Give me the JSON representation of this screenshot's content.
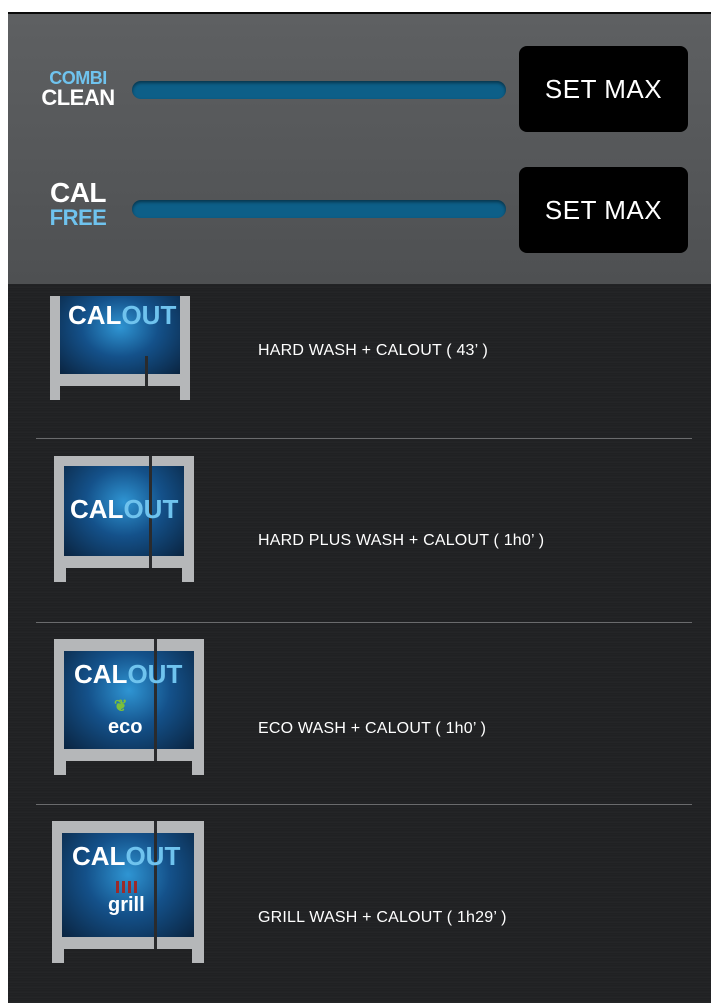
{
  "top_panel": {
    "combi_clean": {
      "line1": "COMBI",
      "line2": "CLEAN",
      "set_label": "SET MAX"
    },
    "cal_free": {
      "line1": "CAL",
      "line2": "FREE",
      "set_label": "SET MAX"
    }
  },
  "programs": [
    {
      "label": "HARD WASH + CALOUT ( 43’ )",
      "icon": {
        "a": "CAL",
        "b": "OUT"
      }
    },
    {
      "label": "HARD PLUS WASH + CALOUT ( 1h0’ )",
      "icon": {
        "a": "CAL",
        "b": "OUT"
      }
    },
    {
      "label": "ECO WASH + CALOUT ( 1h0’ )",
      "icon": {
        "a": "CAL",
        "b": "OUT",
        "sub": "eco"
      }
    },
    {
      "label": "GRILL WASH + CALOUT ( 1h29’ )",
      "icon": {
        "a": "CAL",
        "b": "OUT",
        "sub": "grill"
      }
    }
  ],
  "colors": {
    "accent_blue": "#6fc3ee",
    "slider": "#0d5f88",
    "button": "#000000",
    "panel": "#5a5c5e",
    "list_bg": "#222325"
  }
}
